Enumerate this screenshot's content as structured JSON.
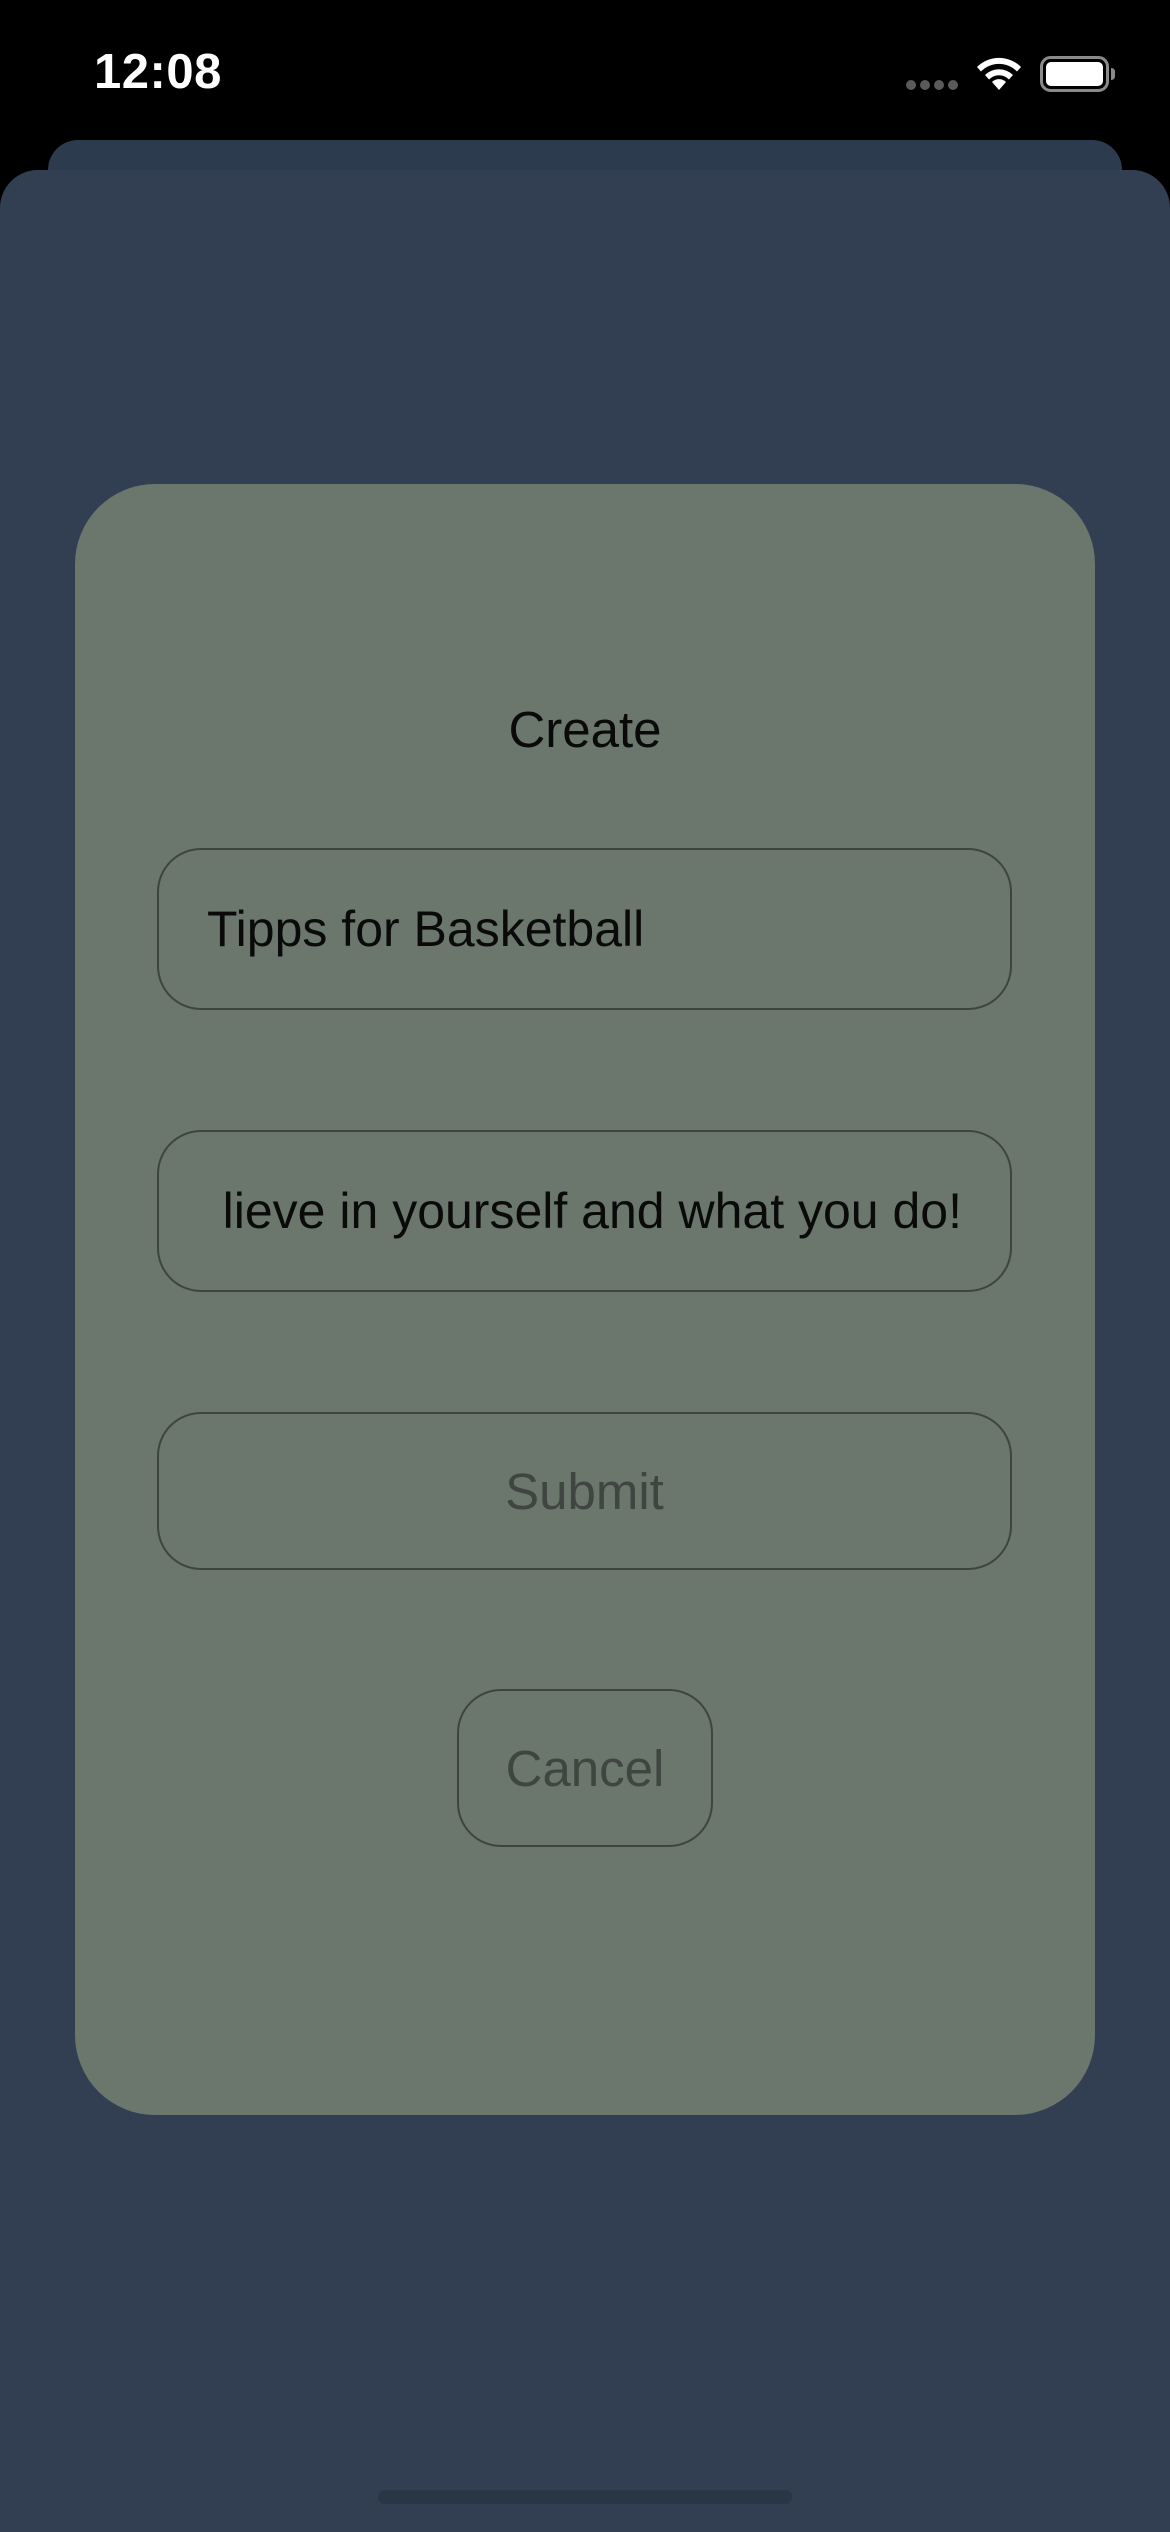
{
  "status_bar": {
    "time": "12:08"
  },
  "icons": {
    "signal": "cellular-signal-icon",
    "wifi": "wifi-icon",
    "battery": "battery-icon"
  },
  "dialog": {
    "title": "Create",
    "title_field": {
      "value": "Tipps for Basketball"
    },
    "content_field": {
      "value": "lieve in yourself and what you do!"
    },
    "submit_label": "Submit",
    "cancel_label": "Cancel"
  },
  "colors": {
    "screen_background": "#000000",
    "sheet_background": "#323f52",
    "card_background": "#6b766d",
    "border": "#3e443f",
    "disabled_text": "#3f4541",
    "text": "#0a0a0a"
  }
}
